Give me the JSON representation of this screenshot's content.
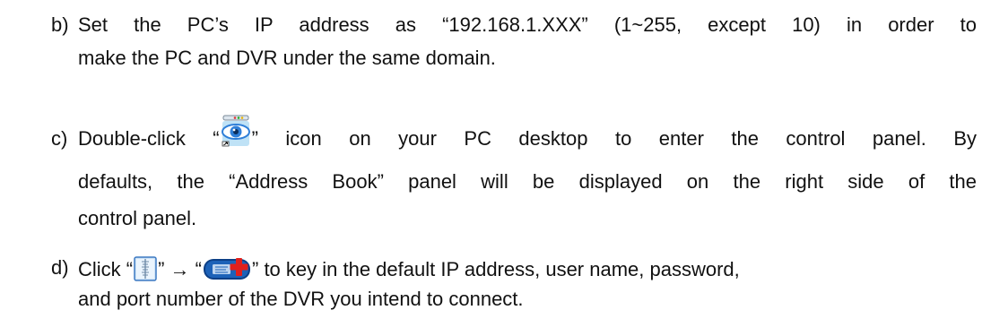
{
  "items": [
    {
      "marker": "b)",
      "line1": "Set the PC’s IP address as “192.168.1.XXX” (1~255, except 10) in order to",
      "line2": "make the PC and DVR under the same domain."
    },
    {
      "marker": "c)",
      "line1_pre": "Double-click “",
      "line1_post": "” icon on your PC desktop to enter the control panel. By",
      "line2": "defaults, the “Address Book” panel will be displayed on the right side of the",
      "line3": "control panel.",
      "icon": "video-viewer-eye-icon"
    },
    {
      "marker": "d)",
      "line1_a": "Click “",
      "line1_b": "” → “",
      "line1_c": "” to key in the default IP address, user name, password,",
      "line2": "and port number of the DVR you intend to connect.",
      "icons": [
        "address-book-icon",
        "add-device-icon"
      ]
    }
  ],
  "colors": {
    "text": "#111111",
    "icon_blue": "#2f7fd8",
    "icon_red": "#e0201c"
  }
}
